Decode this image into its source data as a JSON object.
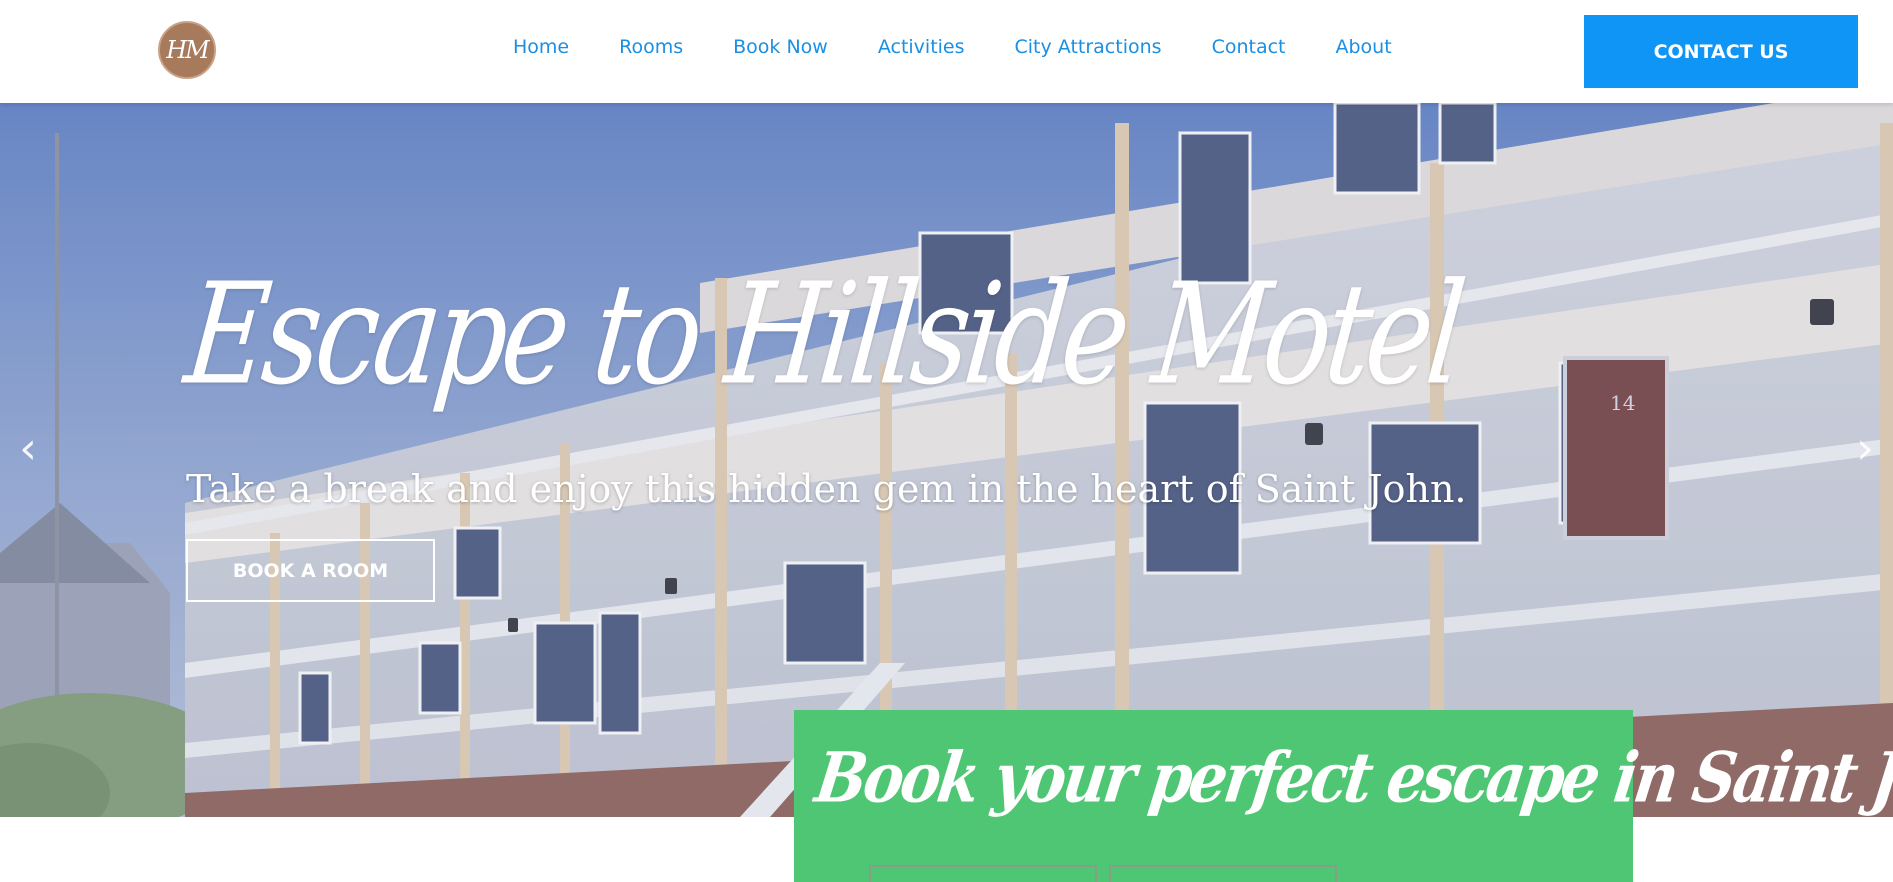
{
  "header": {
    "logo_text": "HM",
    "nav": [
      "Home",
      "Rooms",
      "Book Now",
      "Activities",
      "City Attractions",
      "Contact",
      "About"
    ],
    "cta_label": "CONTACT US"
  },
  "hero": {
    "title": "Escape to Hillside Motel",
    "subtitle": "Take a break and enjoy this hidden gem in the heart of Saint John.",
    "button_label": "BOOK A ROOM",
    "door_number": "14",
    "prev_icon": "chevron-left",
    "next_icon": "chevron-right"
  },
  "booking": {
    "title": "Book your perfect escape in Saint John!"
  },
  "colors": {
    "nav_link": "#1a8fe3",
    "cta_bg": "#0f95f5",
    "booking_bg": "#4fc673",
    "logo_bg": "#a87a5c"
  }
}
